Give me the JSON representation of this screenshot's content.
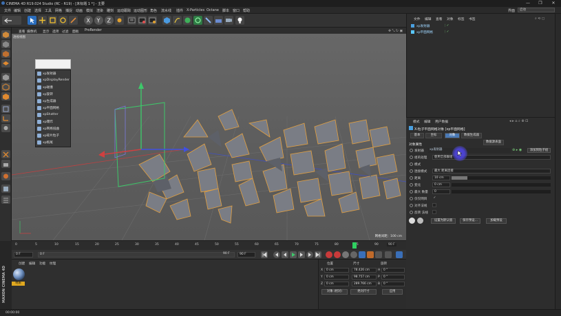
{
  "window": {
    "title": "CINEMA 4D R19.024 Studio (RC - R19) - [未标题 1 *] - 主要",
    "controls": [
      "—",
      "❐",
      "✕"
    ]
  },
  "menubar": {
    "items": [
      "文件",
      "编辑",
      "创建",
      "选择",
      "工具",
      "网格",
      "捕捉",
      "动画",
      "模拟",
      "渲染",
      "雕刻",
      "运动跟踪",
      "运动图形",
      "角色",
      "流水线",
      "插件",
      "X-Particles",
      "Octane",
      "脚本",
      "窗口",
      "帮助"
    ],
    "layout_label": "界面",
    "layout_value": "启动"
  },
  "viewport_menu": {
    "items": [
      "查看",
      "摄像机",
      "显示",
      "选项",
      "过滤",
      "面板",
      "ProRender"
    ],
    "view_label": "透视视图",
    "grid_info": "网格间距：100 cm"
  },
  "context_menu": {
    "items": [
      "xp发射器",
      "xpDisplayRender",
      "xp碰撞",
      "xp旋转",
      "xp生成器",
      "xp平面网格",
      "xpShatter",
      "xp爆炸",
      "xp网格扭曲",
      "xp碎片粒子",
      "xp拖尾"
    ]
  },
  "timeline": {
    "ticks": [
      "0",
      "5",
      "10",
      "15",
      "20",
      "25",
      "30",
      "35",
      "40",
      "45",
      "50",
      "55",
      "60",
      "65",
      "70",
      "75",
      "80",
      "85",
      "90"
    ],
    "end_field": "90 F",
    "current_frame": "0 F",
    "start_field": "0 F",
    "range_end": "90 F",
    "fps_field": "90 F"
  },
  "materials": {
    "tabs": [
      "创建",
      "编辑",
      "功能",
      "纹理"
    ],
    "material_name": "材质"
  },
  "coordinates": {
    "headers": [
      "位置",
      "尺寸",
      "旋转"
    ],
    "rows": [
      {
        "axis": "X",
        "pos": "0 cm",
        "size": "78.426 cm",
        "rot_axis": "H",
        "rot": "0 °"
      },
      {
        "axis": "Y",
        "pos": "0 cm",
        "size": "98.757 cm",
        "rot_axis": "P",
        "rot": "0 °"
      },
      {
        "axis": "Z",
        "pos": "0 cm",
        "size": "289.766 cm",
        "rot_axis": "B",
        "rot": "0 °"
      }
    ],
    "mode_select": "对象 (相对)",
    "size_select": "绝对尺寸",
    "apply_label": "应用"
  },
  "object_manager": {
    "tabs": [
      "文件",
      "编辑",
      "查看",
      "对象",
      "标签",
      "书签"
    ],
    "objects": [
      {
        "name": "xp发射器"
      },
      {
        "name": "xp平面网格"
      }
    ]
  },
  "attributes": {
    "tabs": [
      "模式",
      "编辑",
      "用户数据"
    ],
    "object_title": "X-粒子平面网格对象 [xp平面网格]",
    "subtabs": [
      "基本",
      "坐标",
      "对象",
      "数据生成器",
      "数据源表面"
    ],
    "active_subtab_index": 2,
    "section_title": "对象属性",
    "props": [
      {
        "label": "发射器",
        "value": "xp发射器"
      },
      {
        "label": "组的处理",
        "value": "使用全部群组"
      },
      {
        "label": "模式",
        "value": ""
      },
      {
        "label": "连接模式",
        "value": "最大  距离连接"
      },
      {
        "label": "距离",
        "value": "10 cm"
      },
      {
        "label": "变化",
        "value": "0 cm"
      },
      {
        "label": "最大 数量",
        "value": "0"
      },
      {
        "label": "仅仅网目",
        "value": "✓"
      },
      {
        "label": "对齐法线",
        "value": ""
      },
      {
        "label": "反转 法线",
        "value": ""
      }
    ],
    "add_button": "添加到粒子组",
    "bottom_buttons": [
      "设置为默认值",
      "保存预设...",
      "加载预设"
    ]
  },
  "status": {
    "text": "00:00:00"
  },
  "brand": {
    "vertical_text": "MAXON CINEMA 4D"
  },
  "colors": {
    "accent": "#4a79b5",
    "playhead": "#2fd060",
    "highlight": "#5046e6",
    "selection_orange": "#e0a81f"
  }
}
